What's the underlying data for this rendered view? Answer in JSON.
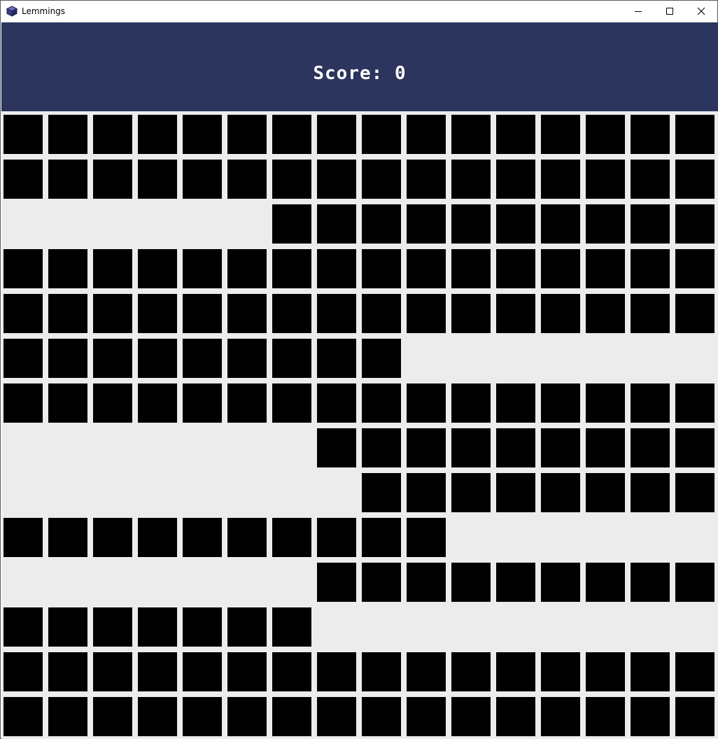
{
  "window": {
    "title": "Lemmings",
    "app_icon": "cube-icon",
    "controls": [
      {
        "name": "minimize-button",
        "icon": "minimize-icon"
      },
      {
        "name": "maximize-button",
        "icon": "maximize-icon"
      },
      {
        "name": "close-button",
        "icon": "close-icon"
      }
    ]
  },
  "hud": {
    "score_label": "Score:",
    "score_value": "0"
  },
  "colors": {
    "hud_background": "#2b355e",
    "playfield_background": "#ececec",
    "block": "#000000"
  },
  "grid": {
    "columns": 16,
    "rows": [
      "1111111111111111",
      "1111111111111111",
      "0000001111111111",
      "1111111111111111",
      "1111111111111111",
      "1111111110000000",
      "1111111111111111",
      "0000000111111111",
      "0000000011111111",
      "1111111111000000",
      "0000000111111111",
      "1111111000000000",
      "1111111111111111",
      "1111111111111111"
    ]
  }
}
